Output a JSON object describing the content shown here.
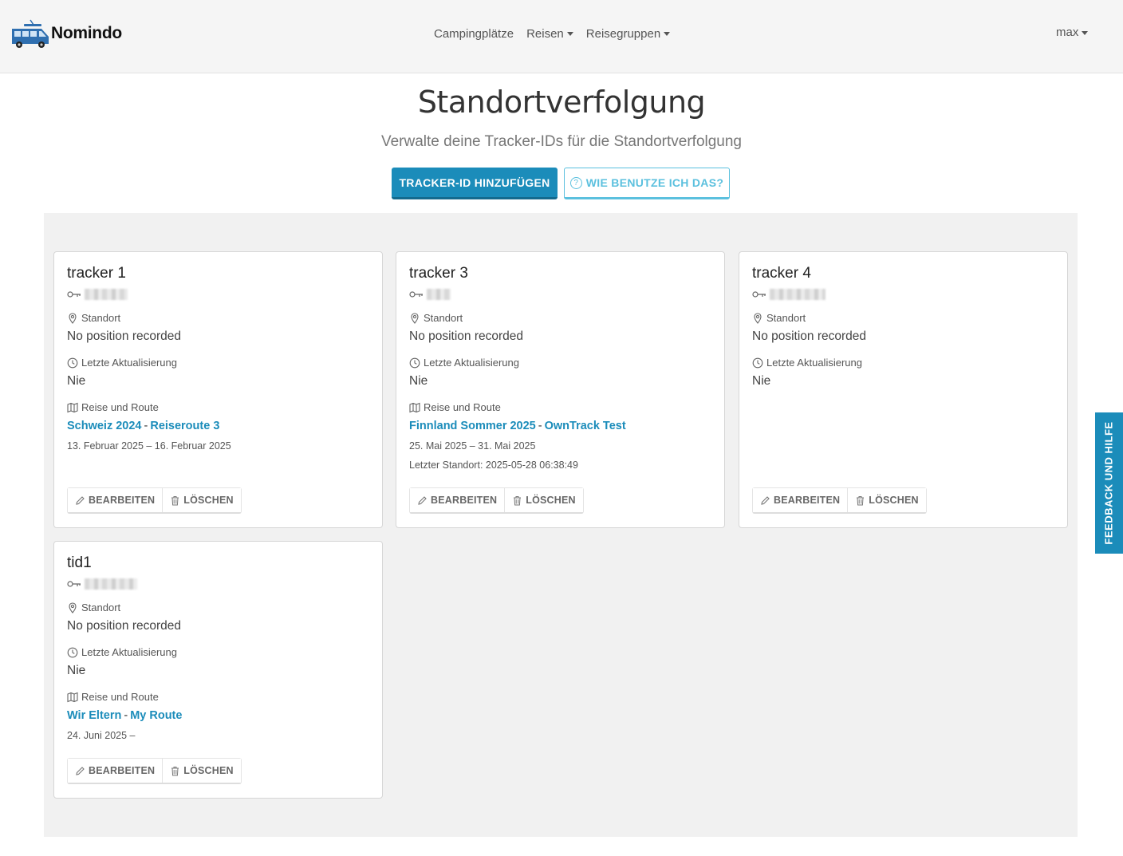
{
  "navbar": {
    "brand": "Nomindo",
    "links": [
      {
        "label": "Campingplätze",
        "dropdown": false
      },
      {
        "label": "Reisen",
        "dropdown": true
      },
      {
        "label": "Reisegruppen",
        "dropdown": true
      }
    ],
    "user": "max"
  },
  "header": {
    "title": "Standortverfolgung",
    "subtitle": "Verwalte deine Tracker-IDs für die Standortverfolgung",
    "add_button": "TRACKER-ID HINZUFÜGEN",
    "help_button": "WIE BENUTZE ICH DAS?",
    "help_icon": "?"
  },
  "labels": {
    "location": "Standort",
    "last_update": "Letzte Aktualisierung",
    "trip_route": "Reise und Route",
    "edit": "BEARBEITEN",
    "delete": "LÖSCHEN"
  },
  "trackers": [
    {
      "name": "tracker 1",
      "position": "No position recorded",
      "last_update": "Nie",
      "trip": "Schweiz 2024",
      "route": "Reiseroute 3",
      "dates": "13. Februar 2025 – 16. Februar 2025",
      "last_location": ""
    },
    {
      "name": "tracker 3",
      "position": "No position recorded",
      "last_update": "Nie",
      "trip": "Finnland Sommer 2025",
      "route": "OwnTrack Test",
      "dates": "25. Mai 2025 – 31. Mai 2025",
      "last_location": "Letzter Standort: 2025-05-28 06:38:49"
    },
    {
      "name": "tracker 4",
      "position": "No position recorded",
      "last_update": "Nie",
      "trip": "",
      "route": "",
      "dates": "",
      "last_location": ""
    },
    {
      "name": "tid1",
      "position": "No position recorded",
      "last_update": "Nie",
      "trip": "Wir Eltern",
      "route": "My Route",
      "dates": "24. Juni 2025 –",
      "last_location": ""
    }
  ],
  "feedback_tab": "FEEDBACK UND HILFE",
  "colors": {
    "primary": "#1b8cba",
    "info": "#5bc0de",
    "navbar_bg": "#f5f5f5",
    "grid_bg": "#f1f1f1"
  },
  "icons": [
    "van-logo-icon",
    "key-icon",
    "map-pin-icon",
    "clock-icon",
    "map-icon",
    "pencil-icon",
    "trash-icon",
    "help-circle-icon"
  ]
}
